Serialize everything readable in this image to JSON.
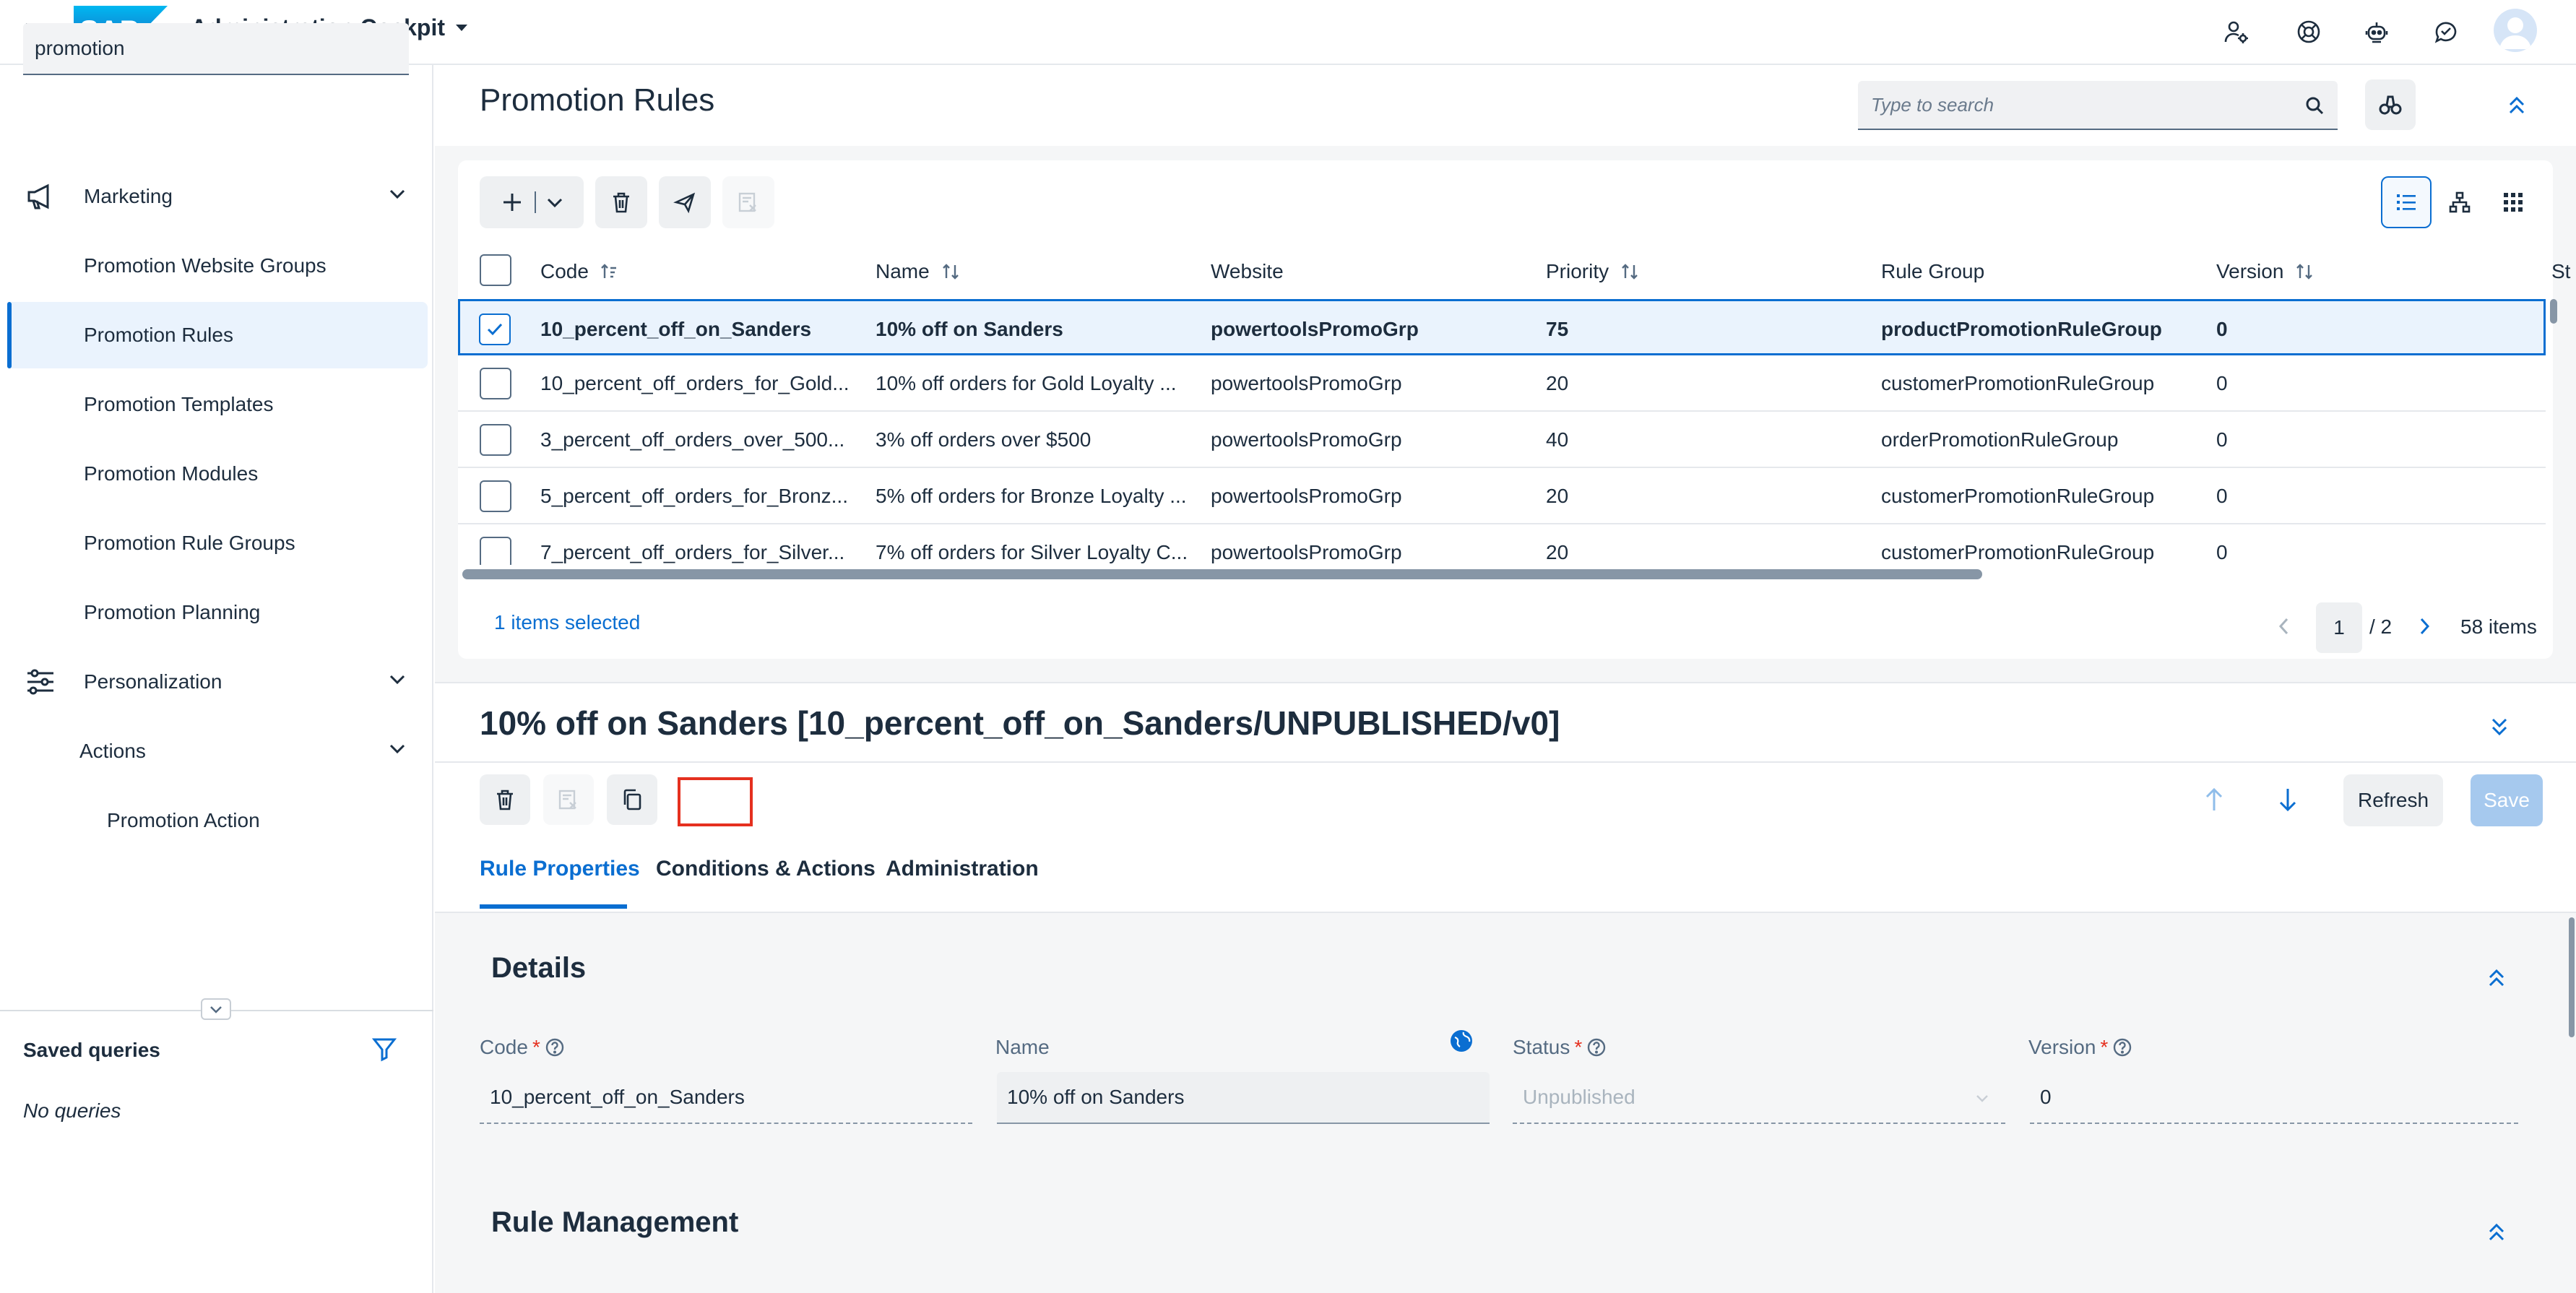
{
  "shell": {
    "logo_text": "SAP",
    "app_title": "Administration Cockpit",
    "icons": [
      "user-settings-icon",
      "support-icon",
      "robot-icon",
      "feedback-icon",
      "avatar"
    ]
  },
  "sidebar": {
    "search_value": "promotion",
    "items": [
      {
        "label": "Marketing",
        "icon": "megaphone-icon",
        "type": "group"
      },
      {
        "label": "Promotion Website Groups",
        "type": "item"
      },
      {
        "label": "Promotion Rules",
        "type": "item",
        "selected": true
      },
      {
        "label": "Promotion Templates",
        "type": "item"
      },
      {
        "label": "Promotion Modules",
        "type": "item"
      },
      {
        "label": "Promotion Rule Groups",
        "type": "item"
      },
      {
        "label": "Promotion Planning",
        "type": "item"
      },
      {
        "label": "Personalization",
        "icon": "sliders-icon",
        "type": "group"
      },
      {
        "label": "Actions",
        "type": "subgroup"
      },
      {
        "label": "Promotion Action",
        "type": "subitem"
      }
    ],
    "saved_queries_title": "Saved queries",
    "no_queries": "No queries"
  },
  "main": {
    "title": "Promotion Rules",
    "search_placeholder": "Type to search"
  },
  "table": {
    "columns": [
      "Code",
      "Name",
      "Website",
      "Priority",
      "Rule Group",
      "Version",
      "St"
    ],
    "rows": [
      {
        "code": "10_percent_off_on_Sanders",
        "name": "10% off on Sanders",
        "website": "powertoolsPromoGrp",
        "priority": "75",
        "group": "productPromotionRuleGroup",
        "version": "0",
        "selected": true
      },
      {
        "code": "10_percent_off_orders_for_Gold...",
        "name": "10% off orders for Gold Loyalty ...",
        "website": "powertoolsPromoGrp",
        "priority": "20",
        "group": "customerPromotionRuleGroup",
        "version": "0",
        "selected": false
      },
      {
        "code": "3_percent_off_orders_over_500...",
        "name": "3% off orders over $500",
        "website": "powertoolsPromoGrp",
        "priority": "40",
        "group": "orderPromotionRuleGroup",
        "version": "0",
        "selected": false
      },
      {
        "code": "5_percent_off_orders_for_Bronz...",
        "name": "5% off orders for Bronze Loyalty ...",
        "website": "powertoolsPromoGrp",
        "priority": "20",
        "group": "customerPromotionRuleGroup",
        "version": "0",
        "selected": false
      },
      {
        "code": "7_percent_off_orders_for_Silver...",
        "name": "7% off orders for Silver Loyalty C...",
        "website": "powertoolsPromoGrp",
        "priority": "20",
        "group": "customerPromotionRuleGroup",
        "version": "0",
        "selected": false
      }
    ],
    "selected_count": "1 items selected",
    "page_current": "1",
    "page_total": "/ 2",
    "items_count": "58 items"
  },
  "detail": {
    "title": "10% off on Sanders [10_percent_off_on_Sanders/UNPUBLISHED/v0]",
    "refresh_label": "Refresh",
    "save_label": "Save",
    "tabs": [
      "Rule Properties",
      "Conditions & Actions",
      "Administration"
    ],
    "details_section": "Details",
    "fields": {
      "code_label": "Code",
      "code_value": "10_percent_off_on_Sanders",
      "name_label": "Name",
      "name_value": "10% off on Sanders",
      "status_label": "Status",
      "status_value": "Unpublished",
      "version_label": "Version",
      "version_value": "0"
    },
    "rule_management_section": "Rule Management"
  },
  "colors": {
    "accent": "#0a6ed1",
    "selected_row_bg": "#eaf3fd",
    "highlight_box": "#e5301f",
    "save_disabled": "#a6c9ee"
  }
}
